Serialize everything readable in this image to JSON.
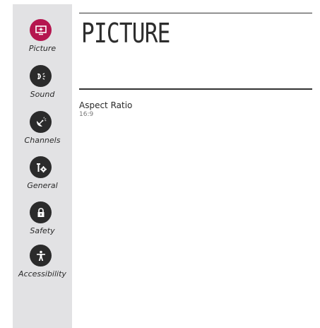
{
  "sidebar": {
    "items": [
      {
        "label": "Picture",
        "icon": "picture-icon",
        "active": true
      },
      {
        "label": "Sound",
        "icon": "sound-icon",
        "active": false
      },
      {
        "label": "Channels",
        "icon": "satellite-dish-icon",
        "active": false
      },
      {
        "label": "General",
        "icon": "tools-gear-icon",
        "active": false
      },
      {
        "label": "Safety",
        "icon": "lock-icon",
        "active": false
      },
      {
        "label": "Accessibility",
        "icon": "accessibility-icon",
        "active": false
      }
    ]
  },
  "main": {
    "title": "PICTURE",
    "settings": [
      {
        "label": "Aspect Ratio",
        "value": "16:9"
      }
    ]
  },
  "colors": {
    "accent": "#b5164f",
    "icon_bg": "#2b2b2b",
    "sidebar_bg": "#e2e2e4"
  }
}
